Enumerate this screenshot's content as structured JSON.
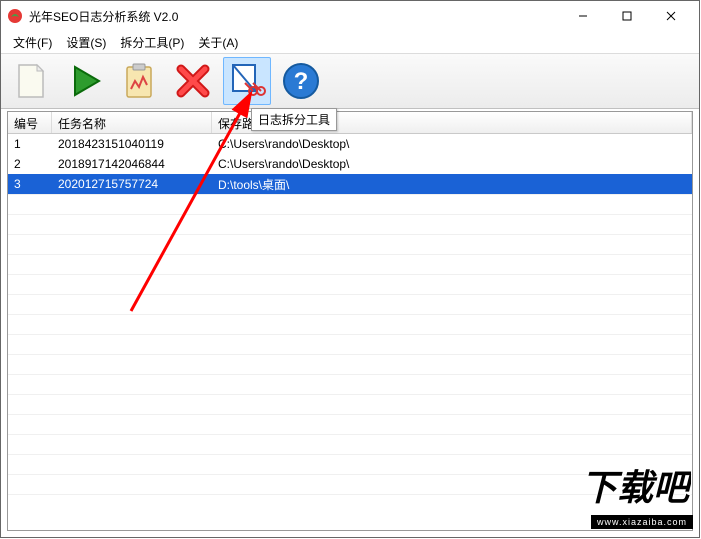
{
  "window": {
    "title": "光年SEO日志分析系统 V2.0"
  },
  "menu": {
    "file": "文件(F)",
    "settings": "设置(S)",
    "split_tools": "拆分工具(P)",
    "about": "关于(A)"
  },
  "toolbar": {
    "tooltip_split": "日志拆分工具",
    "icons": {
      "new": "new-doc-icon",
      "run": "play-icon",
      "report": "clipboard-icon",
      "delete": "delete-x-icon",
      "split": "split-tool-icon",
      "help": "help-icon"
    }
  },
  "grid": {
    "headers": {
      "id": "编号",
      "name": "任务名称",
      "path": "保存路径"
    },
    "rows": [
      {
        "id": "1",
        "name": "2018423151040119",
        "path": "C:\\Users\\rando\\Desktop\\"
      },
      {
        "id": "2",
        "name": "2018917142046844",
        "path": "C:\\Users\\rando\\Desktop\\"
      },
      {
        "id": "3",
        "name": "202012715757724",
        "path": "D:\\tools\\桌面\\",
        "selected": true
      }
    ]
  },
  "watermark": {
    "text": "下载吧",
    "url": "www.xiazaiba.com"
  }
}
